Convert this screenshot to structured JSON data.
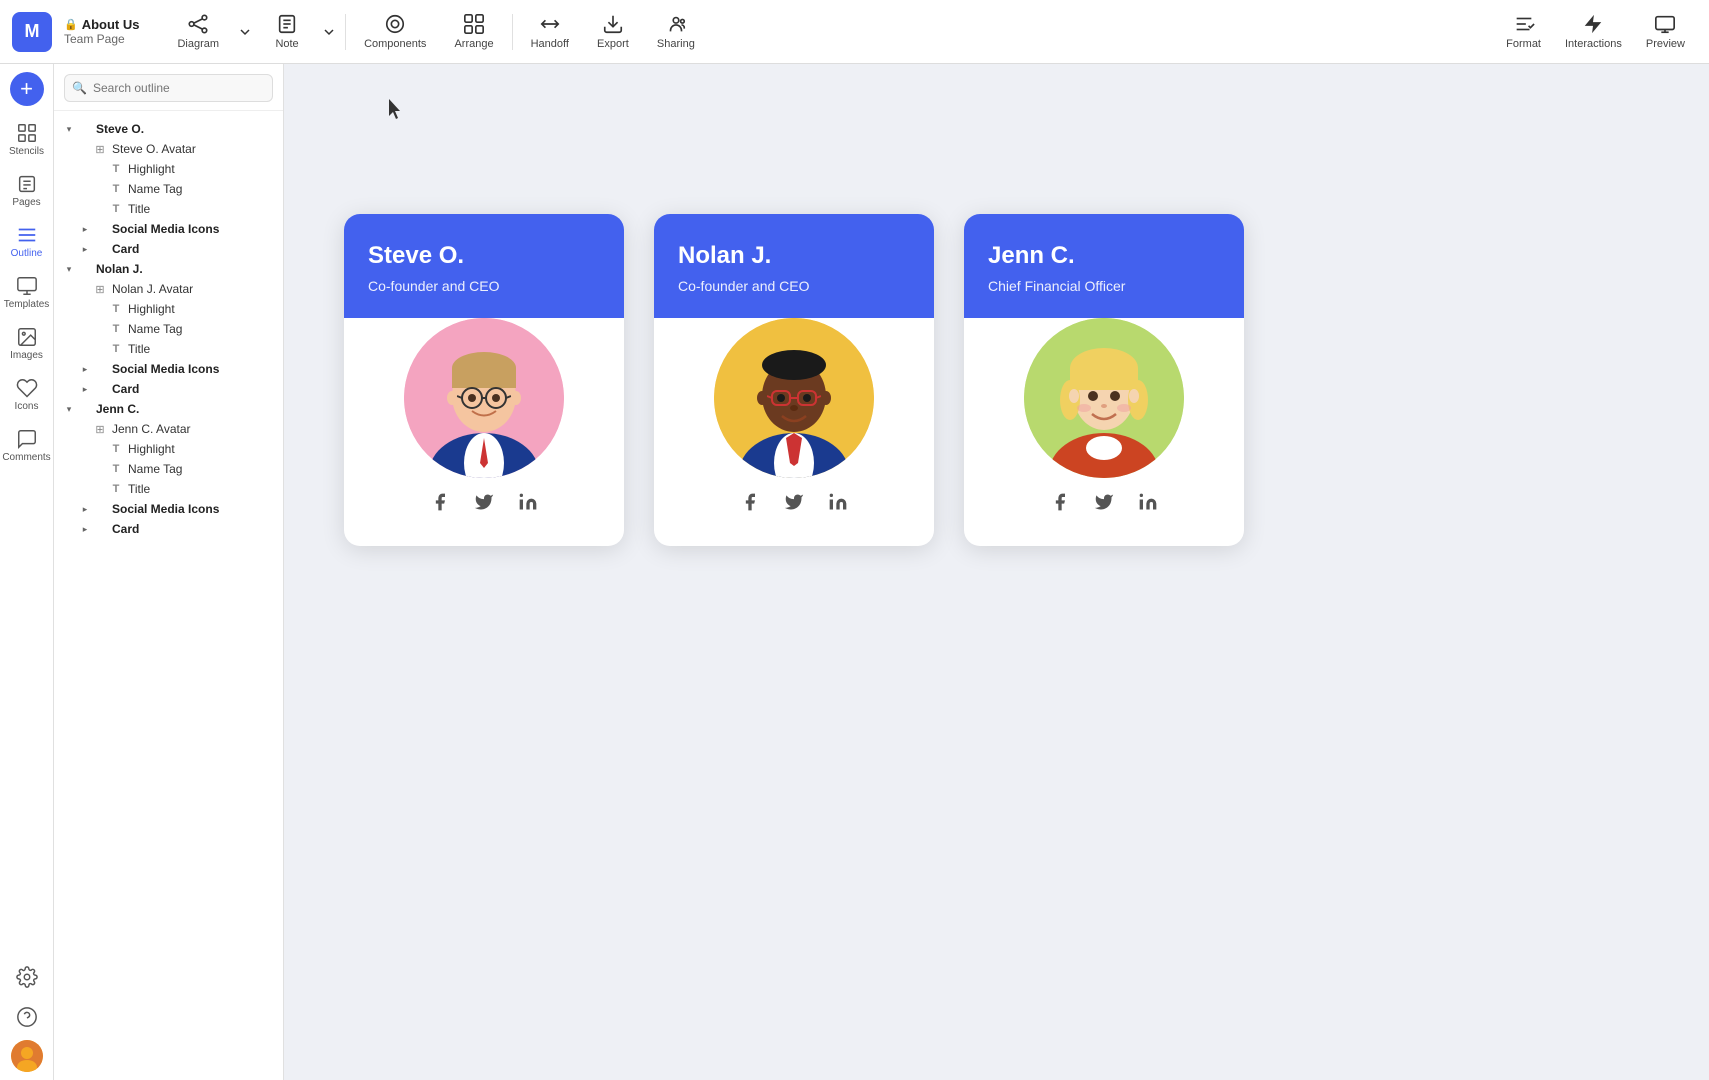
{
  "app": {
    "logo": "M",
    "breadcrumb_top": "About Us",
    "breadcrumb_sub": "Team Page",
    "lock_icon": "🔒"
  },
  "toolbar": {
    "items": [
      {
        "id": "diagram",
        "label": "Diagram",
        "icon": "diagram"
      },
      {
        "id": "note",
        "label": "Note",
        "icon": "note"
      },
      {
        "id": "components",
        "label": "Components",
        "icon": "components"
      },
      {
        "id": "arrange",
        "label": "Arrange",
        "icon": "arrange"
      },
      {
        "id": "handoff",
        "label": "Handoff",
        "icon": "handoff"
      },
      {
        "id": "export",
        "label": "Export",
        "icon": "export"
      },
      {
        "id": "sharing",
        "label": "Sharing",
        "icon": "sharing"
      }
    ],
    "right_items": [
      {
        "id": "format",
        "label": "Format",
        "icon": "format"
      },
      {
        "id": "interactions",
        "label": "Interactions",
        "icon": "interactions"
      },
      {
        "id": "preview",
        "label": "Preview",
        "icon": "preview"
      }
    ]
  },
  "left_nav": {
    "items": [
      {
        "id": "stencils",
        "label": "Stencils",
        "icon": "stencils"
      },
      {
        "id": "pages",
        "label": "Pages",
        "icon": "pages"
      },
      {
        "id": "outline",
        "label": "Outline",
        "icon": "outline",
        "active": true
      },
      {
        "id": "templates",
        "label": "Templates",
        "icon": "templates"
      },
      {
        "id": "images",
        "label": "Images",
        "icon": "images"
      },
      {
        "id": "icons",
        "label": "Icons",
        "icon": "icons"
      },
      {
        "id": "comments",
        "label": "Comments",
        "icon": "comments"
      }
    ]
  },
  "outline": {
    "search_placeholder": "Search outline",
    "tree": [
      {
        "level": 0,
        "type": "group",
        "label": "Steve O.",
        "expanded": true
      },
      {
        "level": 1,
        "type": "image",
        "label": "Steve O. Avatar",
        "expanded": false
      },
      {
        "level": 2,
        "type": "text",
        "label": "Highlight"
      },
      {
        "level": 2,
        "type": "text",
        "label": "Name Tag"
      },
      {
        "level": 2,
        "type": "text",
        "label": "Title"
      },
      {
        "level": 1,
        "type": "group",
        "label": "Social Media Icons",
        "expanded": false
      },
      {
        "level": 1,
        "type": "group",
        "label": "Card",
        "expanded": false
      },
      {
        "level": 0,
        "type": "group",
        "label": "Nolan J.",
        "expanded": true
      },
      {
        "level": 1,
        "type": "image",
        "label": "Nolan J. Avatar",
        "expanded": false
      },
      {
        "level": 2,
        "type": "text",
        "label": "Highlight"
      },
      {
        "level": 2,
        "type": "text",
        "label": "Name Tag"
      },
      {
        "level": 2,
        "type": "text",
        "label": "Title"
      },
      {
        "level": 1,
        "type": "group",
        "label": "Social Media Icons",
        "expanded": false
      },
      {
        "level": 1,
        "type": "group",
        "label": "Card",
        "expanded": false
      },
      {
        "level": 0,
        "type": "group",
        "label": "Jenn C.",
        "expanded": true
      },
      {
        "level": 1,
        "type": "image",
        "label": "Jenn C. Avatar",
        "expanded": false
      },
      {
        "level": 2,
        "type": "text",
        "label": "Highlight"
      },
      {
        "level": 2,
        "type": "text",
        "label": "Name Tag"
      },
      {
        "level": 2,
        "type": "text",
        "label": "Title"
      },
      {
        "level": 1,
        "type": "group",
        "label": "Social Media Icons",
        "expanded": false
      },
      {
        "level": 1,
        "type": "group",
        "label": "Card",
        "expanded": false
      }
    ]
  },
  "cards": [
    {
      "id": "steve",
      "name": "Steve O.",
      "title": "Co-founder and CEO",
      "avatar_bg": "#f4a4c0",
      "social": [
        "facebook",
        "twitter",
        "linkedin"
      ]
    },
    {
      "id": "nolan",
      "name": "Nolan J.",
      "title": "Co-founder and CEO",
      "avatar_bg": "#f0c040",
      "social": [
        "facebook",
        "twitter",
        "linkedin"
      ]
    },
    {
      "id": "jenn",
      "name": "Jenn C.",
      "title": "Chief Financial Officer",
      "avatar_bg": "#b8d96e",
      "social": [
        "facebook",
        "twitter",
        "linkedin"
      ]
    }
  ],
  "colors": {
    "brand": "#4361ee",
    "card_header": "#4361ee",
    "bg": "#eef0f5"
  }
}
